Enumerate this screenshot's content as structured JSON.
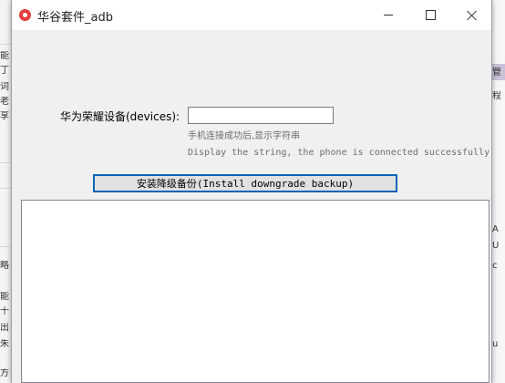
{
  "background": {
    "left_glyphs": [
      "能",
      "丁",
      "词",
      "老",
      "享",
      "略",
      "能",
      "十",
      "出",
      "朱",
      "方"
    ],
    "right_glyphs": [
      "管",
      "程",
      "A",
      "U",
      "c",
      "u"
    ]
  },
  "window": {
    "title": "华谷套件_adb",
    "icon": "app-logo-icon",
    "accent": "#0a64b7"
  },
  "form": {
    "devices_label": "华为荣耀设备(devices):",
    "devices_value": "",
    "hint_cn": "手机连接成功后,显示字符串",
    "hint_en": "Display the string, the phone is connected successfully",
    "install_button": "安装降级备份(Install downgrade backup)"
  },
  "output": {
    "text": ""
  }
}
